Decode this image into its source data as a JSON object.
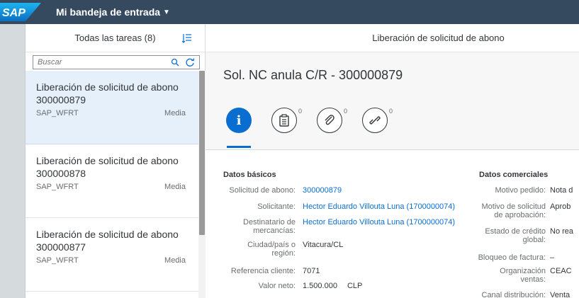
{
  "shell": {
    "logo_text": "SAP",
    "app_title": "Mi bandeja de entrada"
  },
  "master": {
    "header": "Todas las tareas (8)",
    "search_placeholder": "Buscar",
    "items": [
      {
        "title_line1": "Liberación de solicitud de abono",
        "title_line2": "300000879",
        "creator": "SAP_WFRT",
        "priority": "Media"
      },
      {
        "title_line1": "Liberación de solicitud de abono",
        "title_line2": "300000878",
        "creator": "SAP_WFRT",
        "priority": "Media"
      },
      {
        "title_line1": "Liberación de solicitud de abono",
        "title_line2": "300000877",
        "creator": "SAP_WFRT",
        "priority": "Media"
      }
    ]
  },
  "detail": {
    "page_title": "Liberación de solicitud de abono",
    "object_title": "Sol. NC anula C/R - 300000879",
    "tabs": [
      {
        "icon": "info-icon",
        "count": ""
      },
      {
        "icon": "clipboard-icon",
        "count": "0"
      },
      {
        "icon": "paperclip-icon",
        "count": "0"
      },
      {
        "icon": "link-icon",
        "count": "0"
      }
    ],
    "basic": {
      "title": "Datos básicos",
      "fields": [
        {
          "label": "Solicitud de abono:",
          "value": "300000879"
        },
        {
          "label": "Solicitante:",
          "value": "Hector Eduardo Villouta Luna (1700000074)"
        },
        {
          "label_l1": "Destinatario de",
          "label_l2": "mercancías:",
          "value": "Hector Eduardo Villouta Luna (1700000074)"
        },
        {
          "label_l1": "Ciudad/país o",
          "label_l2": "región:",
          "value": "Vitacura/CL"
        },
        {
          "label": "Referencia cliente:",
          "value": "7071"
        },
        {
          "label": "Valor neto:",
          "value": "1.500.000",
          "currency": "CLP"
        }
      ]
    },
    "commercial": {
      "title": "Datos comerciales",
      "fields": [
        {
          "label": "Motivo pedido:",
          "value": "Nota d"
        },
        {
          "label_l1": "Motivo de solicitud",
          "label_l2": "de aprobación:",
          "value": "Aprob"
        },
        {
          "label_l1": "Estado de crédito",
          "label_l2": "global:",
          "value": "No rea"
        },
        {
          "label": "Bloqueo de factura:",
          "value": "–"
        },
        {
          "label_l1": "Organización",
          "label_l2": "ventas:",
          "value": "CEAC"
        },
        {
          "label": "Canal distribución:",
          "value": "Venta"
        }
      ]
    }
  },
  "colors": {
    "shell": "#354a5f",
    "accent": "#0a6ed1",
    "selected": "#e5f0fa"
  }
}
